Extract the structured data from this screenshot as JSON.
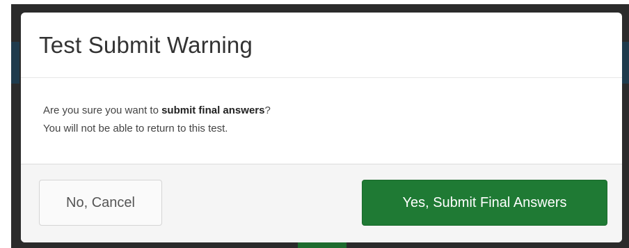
{
  "dialog": {
    "title": "Test Submit Warning",
    "body": {
      "line1_prefix": "Are you sure you want to ",
      "line1_bold": "submit final answers",
      "line1_suffix": "?",
      "line2": "You will not be able to return to this test."
    },
    "buttons": {
      "cancel_label": "No, Cancel",
      "submit_label": "Yes, Submit Final Answers"
    }
  },
  "colors": {
    "submit_button": "#1f7a34",
    "backdrop": "#2b2b2b"
  }
}
